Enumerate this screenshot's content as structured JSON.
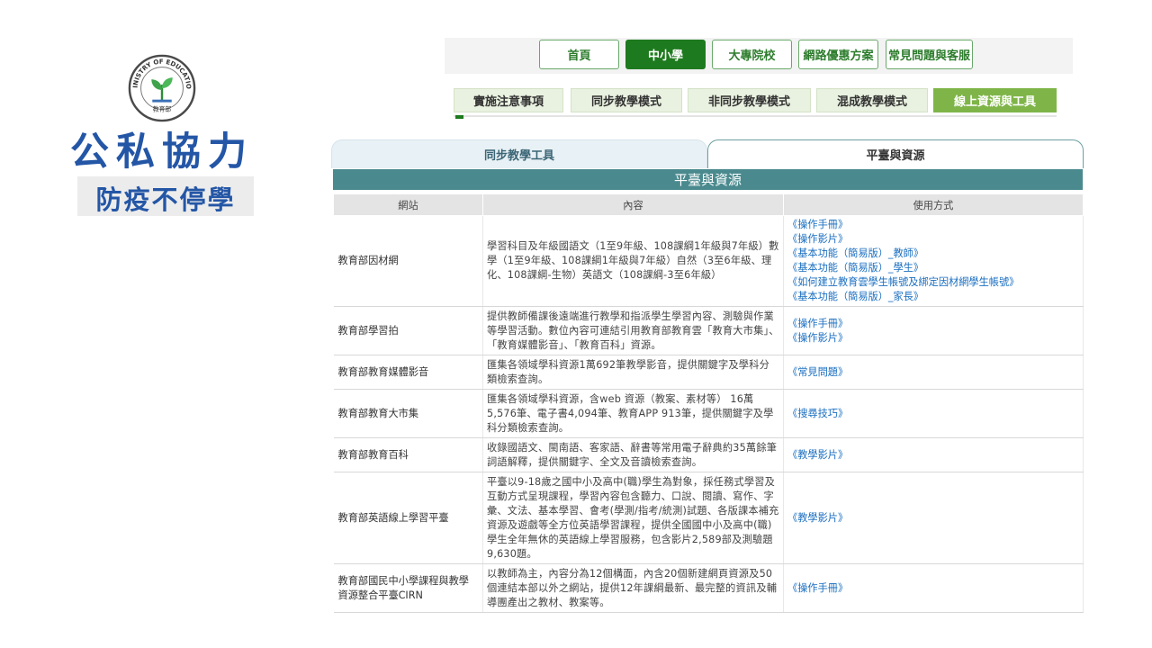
{
  "logo": {
    "brand_line1": "公私協力",
    "brand_line2": "防疫不停學",
    "seal_text": "MINISTRY OF EDUCATION",
    "seal_bottom": "教育部"
  },
  "main_nav": [
    {
      "label": "首頁",
      "active": false
    },
    {
      "label": "中小學",
      "active": true
    },
    {
      "label": "大專院校",
      "active": false
    },
    {
      "label": "網路優惠方案",
      "active": false
    },
    {
      "label": "常見問題與客服",
      "active": false
    }
  ],
  "sub_nav": [
    {
      "label": "實施注意事項",
      "active": false
    },
    {
      "label": "同步教學模式",
      "active": false
    },
    {
      "label": "非同步教學模式",
      "active": false
    },
    {
      "label": "混成教學模式",
      "active": false
    },
    {
      "label": "線上資源與工具",
      "active": true
    }
  ],
  "tabs": [
    {
      "label": "同步教學工具",
      "active": false
    },
    {
      "label": "平臺與資源",
      "active": true
    }
  ],
  "table": {
    "title": "平臺與資源",
    "headers": [
      "網站",
      "內容",
      "使用方式"
    ],
    "rows": [
      {
        "site": "教育部因材網",
        "content": "學習科目及年級國語文（1至9年級、108課綱1年級與7年級）數學（1至9年級、108課綱1年級與7年級）自然（3至6年級、理化、108課綱-生物）英語文（108課綱-3至6年級）",
        "usage": [
          "《操作手冊》",
          "《操作影片》",
          "《基本功能（簡易版）_教師》",
          "《基本功能（簡易版）_學生》",
          "《如何建立教育雲學生帳號及綁定因材網學生帳號》",
          "《基本功能（簡易版）_家長》"
        ]
      },
      {
        "site": "教育部學習拍",
        "content": "提供教師備課後遠端進行教學和指派學生學習內容、測驗與作業等學習活動。數位內容可連結引用教育部教育雲「教育大市集」、「教育媒體影音」、「教育百科」資源。",
        "usage": [
          "《操作手冊》",
          "《操作影片》"
        ]
      },
      {
        "site": "教育部教育媒體影音",
        "content": "匯集各領域學科資源1萬692筆教學影音，提供關鍵字及學科分類檢索查詢。",
        "usage": [
          "《常見問題》"
        ]
      },
      {
        "site": "教育部教育大市集",
        "content": "匯集各領域學科資源，含web 資源（教案、素材等） 16萬5,576筆、電子書4,094筆、教育APP 913筆，提供關鍵字及學科分類檢索查詢。",
        "usage": [
          "《搜尋技巧》"
        ]
      },
      {
        "site": "教育部教育百科",
        "content": "收錄國語文、閩南語、客家語、辭書等常用電子辭典約35萬餘筆詞語解釋，提供關鍵字、全文及音讀檢索查詢。",
        "usage": [
          "《教學影片》"
        ]
      },
      {
        "site": "教育部英語線上學習平臺",
        "content": "平臺以9-18歲之國中小及高中(職)學生為對象，採任務式學習及互動方式呈現課程，學習內容包含聽力、口說、閱讀、寫作、字彙、文法、基本學習、會考(學測/指考/統測)試題、各版課本補充資源及遊戲等全方位英語學習課程，提供全國國中小及高中(職)學生全年無休的英語線上學習服務，包含影片2,589部及測驗題9,630題。",
        "usage": [
          "《教學影片》"
        ]
      },
      {
        "site": "教育部國民中小學課程與教學資源整合平臺CIRN",
        "content": "以教師為主，內容分為12個構面，內含20個新建網頁資源及50個連結本部以外之網站，提供12年課綱最新、最完整的資訊及輔導團產出之教材、教案等。",
        "usage": [
          "《操作手冊》"
        ]
      }
    ]
  }
}
